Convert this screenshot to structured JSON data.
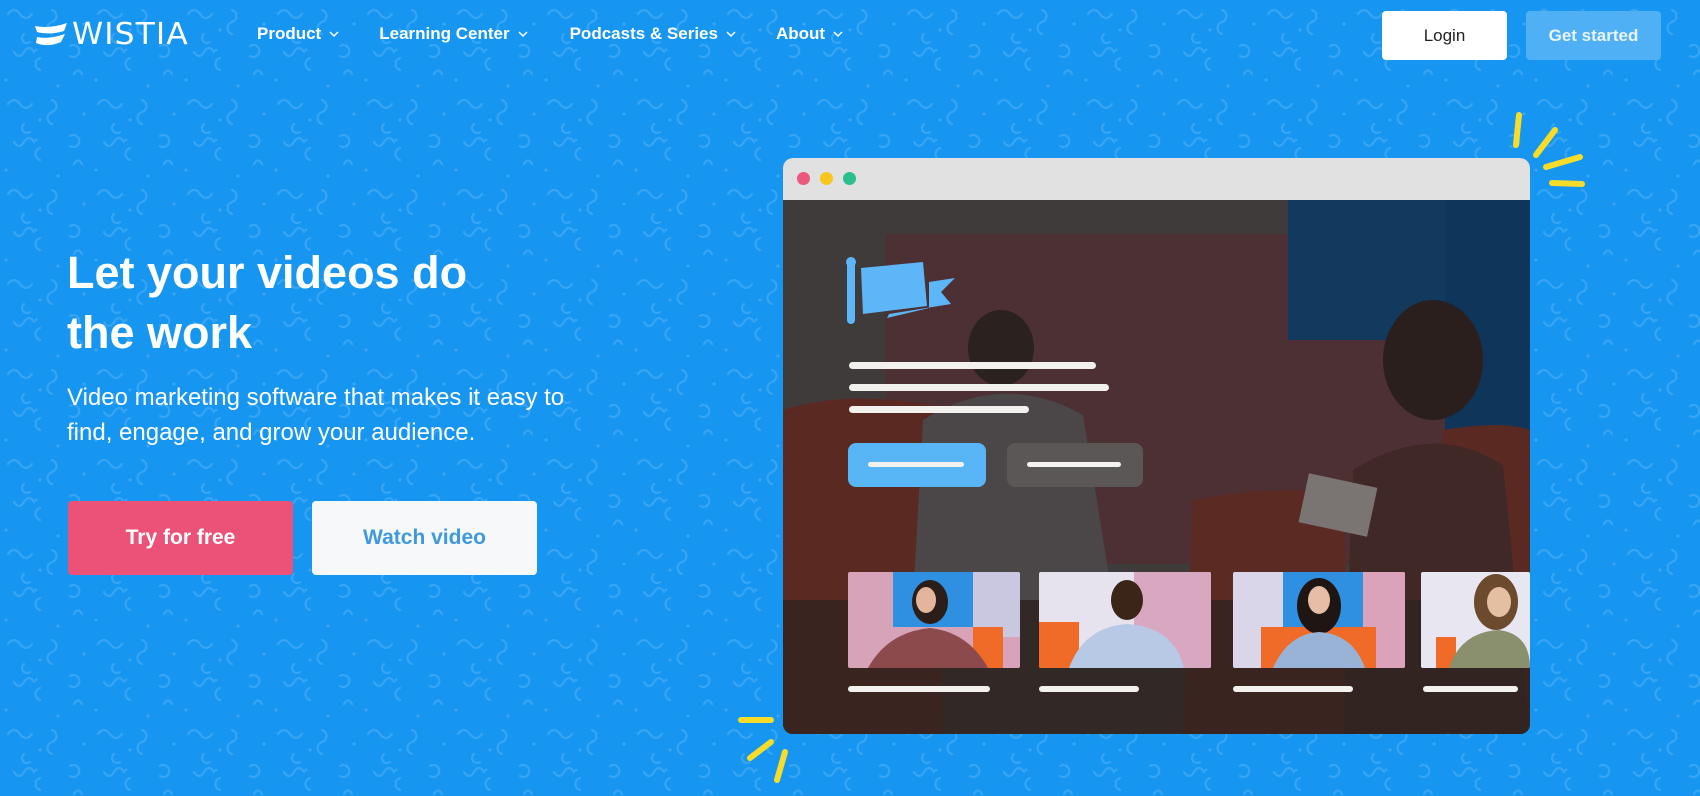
{
  "brand": {
    "name": "WISTIA",
    "logo_icon": "wistia-wave-logo-icon",
    "background_color": "#1696f0"
  },
  "nav": {
    "items": [
      {
        "label": "Product",
        "icon": "chevron-down-icon"
      },
      {
        "label": "Learning Center",
        "icon": "chevron-down-icon"
      },
      {
        "label": "Podcasts & Series",
        "icon": "chevron-down-icon"
      },
      {
        "label": "About",
        "icon": "chevron-down-icon"
      }
    ],
    "login_label": "Login",
    "get_started_label": "Get started"
  },
  "hero": {
    "title_line1": "Let your videos do",
    "title_line2": "the work",
    "subtitle_line1": "Video marketing software that makes it easy to",
    "subtitle_line2": "find, engage, and grow your audience.",
    "primary_cta": "Try for free",
    "secondary_cta": "Watch video"
  },
  "colors": {
    "primary_cta": "#ec5177",
    "secondary_cta_text": "#3f99dc",
    "get_started_bg": "#4fb0f5",
    "accent_yellow": "#f8dc2a",
    "window_dot_red": "#ec5a7b",
    "window_dot_yellow": "#f8c71f",
    "window_dot_green": "#2bbf8c"
  },
  "illustration": {
    "description": "browser-window-video-mockup",
    "icons": [
      "flag-icon"
    ],
    "thumbnails": [
      {
        "name": "thumbnail-woman-plaid-shirt"
      },
      {
        "name": "thumbnail-man-blue-shirt"
      },
      {
        "name": "thumbnail-woman-denim-shirt"
      },
      {
        "name": "thumbnail-man-glasses"
      }
    ]
  }
}
